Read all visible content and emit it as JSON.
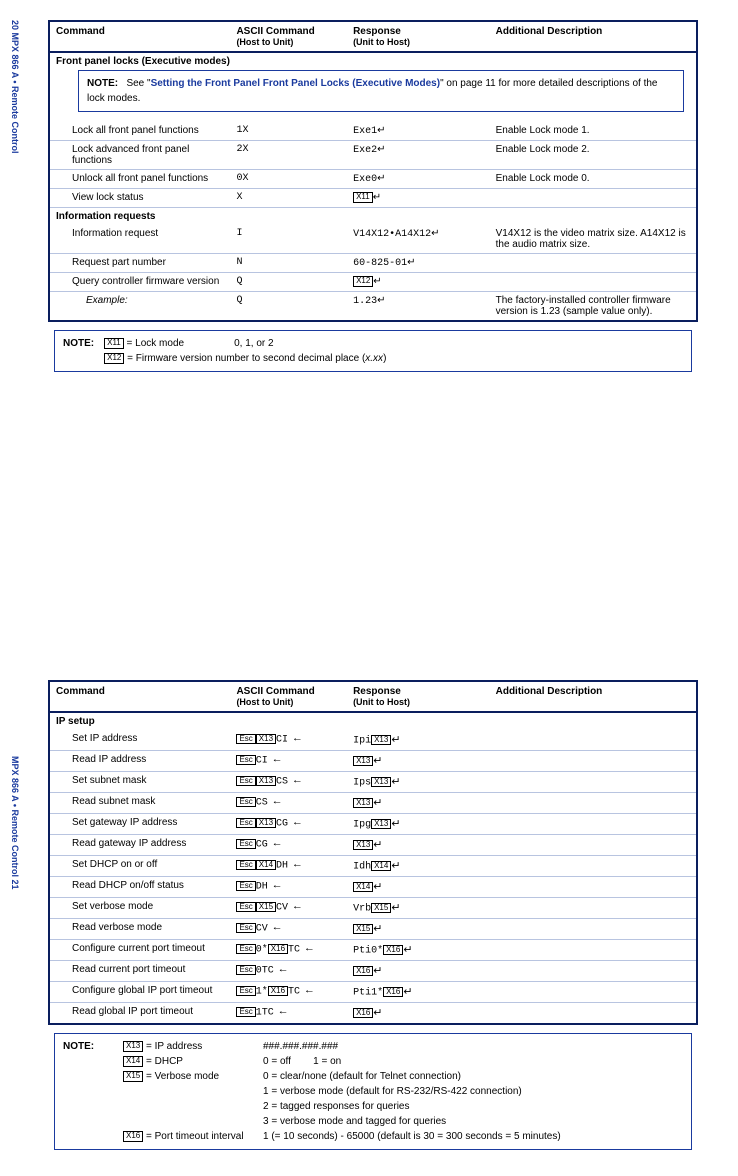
{
  "sideLabel1": "20   MPX 866 A • Remote Control",
  "sideLabel2": "MPX 866 A • Remote Control   21",
  "hdr": {
    "c1": "Command",
    "c2": "ASCII Command",
    "c2s": "(Host to Unit)",
    "c3": "Response",
    "c3s": "(Unit to Host)",
    "c4": "Additional Description"
  },
  "t1": {
    "sec1": "Front panel locks (Executive modes)",
    "note": {
      "lead": "NOTE:",
      "pre": "See \"",
      "link": "Setting the Front Panel Front Panel Locks (Executive Modes)",
      "post": "\" on page 11 for more detailed descriptions of the lock modes."
    },
    "r": [
      {
        "a": "Lock all front panel functions",
        "b": "1X",
        "c": "Exe1↵",
        "d": "Enable Lock mode 1."
      },
      {
        "a": "Lock advanced front panel functions",
        "b": "2X",
        "c": "Exe2↵",
        "d": "Enable Lock mode 2."
      },
      {
        "a": "Unlock all front panel functions",
        "b": "0X",
        "c": "Exe0↵",
        "d": "Enable Lock mode 0."
      },
      {
        "a": "View lock status",
        "b": "X",
        "c": "[X11]↵",
        "d": ""
      }
    ],
    "sec2": "Information requests",
    "r2": [
      {
        "a": "Information request",
        "b": "I",
        "c": "V14X12•A14X12↵",
        "d": "V14X12 is the video matrix size. A14X12 is the audio matrix size."
      },
      {
        "a": "Request part number",
        "b": "N",
        "c": "60-825-01↵",
        "d": ""
      },
      {
        "a": "Query controller firmware version",
        "b": "Q",
        "c": "[X12]↵",
        "d": ""
      },
      {
        "a": "Example:",
        "b": "Q",
        "c": "1.23↵",
        "d": "The factory-installed controller firmware version is 1.23 (sample value only)."
      }
    ]
  },
  "note1": {
    "lead": "NOTE:",
    "l1a": "[X11]",
    "l1b": " = Lock mode",
    "l1c": "0, 1, or 2",
    "l2a": "[X12]",
    "l2b": " = Firmware version number to second decimal place (",
    "l2c": "x.xx",
    "l2d": ")"
  },
  "t2": {
    "sec": "IP setup",
    "r": [
      {
        "a": "Set IP address",
        "b": "[Esc][X13]CI ←",
        "c": "Ipi[X13]↵"
      },
      {
        "a": "Read IP address",
        "b": "[Esc]CI ←",
        "c": "[X13]↵"
      },
      {
        "a": "Set subnet mask",
        "b": "[Esc][X13]CS ←",
        "c": "Ips[X13]↵"
      },
      {
        "a": "Read subnet mask",
        "b": "[Esc]CS ←",
        "c": "[X13]↵"
      },
      {
        "a": "Set gateway IP address",
        "b": "[Esc][X13]CG ←",
        "c": "Ipg[X13]↵"
      },
      {
        "a": "Read gateway IP address",
        "b": "[Esc]CG ←",
        "c": "[X13]↵"
      },
      {
        "a": "Set DHCP on or off",
        "b": "[Esc][X14]DH ←",
        "c": "Idh[X14]↵"
      },
      {
        "a": "Read DHCP on/off status",
        "b": "[Esc]DH ←",
        "c": "[X14]↵"
      },
      {
        "a": "Set verbose mode",
        "b": "[Esc][X15]CV ←",
        "c": "Vrb[X15]↵"
      },
      {
        "a": "Read verbose mode",
        "b": "[Esc]CV ←",
        "c": "[X15]↵"
      },
      {
        "a": "Configure current port timeout",
        "b": "[Esc]0*[X16]TC ←",
        "c": "Pti0*[X16]↵"
      },
      {
        "a": "Read current port timeout",
        "b": "[Esc]0TC ←",
        "c": "[X16]↵"
      },
      {
        "a": "Configure global IP port timeout",
        "b": "[Esc]1*[X16]TC ←",
        "c": "Pti1*[X16]↵"
      },
      {
        "a": "Read global IP port timeout",
        "b": "[Esc]1TC ←",
        "c": "[X16]↵"
      }
    ]
  },
  "note2": {
    "lead": "NOTE:",
    "x13": "[X13]",
    "x13t": " = IP address",
    "x13v": "###.###.###.###",
    "x14": "[X14]",
    "x14t": " = DHCP",
    "x14v1": "0 = off",
    "x14v2": "1 = on",
    "x15": "[X15]",
    "x15t": " = Verbose mode",
    "vm0": "0 = clear/none (default for Telnet connection)",
    "vm1": "1 = verbose mode (default for RS-232/RS-422 connection)",
    "vm2": "2 = tagged responses for queries",
    "vm3": "3 = verbose mode and tagged for queries",
    "x16": "[X16]",
    "x16t": " = Port timeout interval",
    "x16v": "1 (= 10 seconds) - 65000 (default is 30 = 300 seconds = 5 minutes)"
  }
}
